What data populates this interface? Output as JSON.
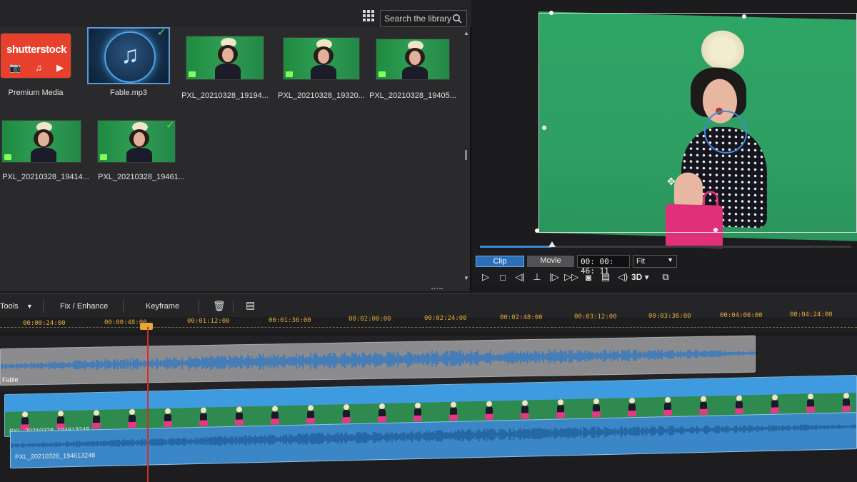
{
  "library": {
    "search_placeholder": "Search the library",
    "items": [
      {
        "label": "Premium Media",
        "kind": "shutterstock",
        "logo": "shutterstock"
      },
      {
        "label": "Fable.mp3",
        "kind": "music",
        "checked": true
      },
      {
        "label": "PXL_20210328_19194...",
        "kind": "video"
      },
      {
        "label": "PXL_20210328_19320...",
        "kind": "video"
      },
      {
        "label": "PXL_20210328_19405...",
        "kind": "video"
      },
      {
        "label": "PXL_20210328_19414...",
        "kind": "video"
      },
      {
        "label": "PXL_20210328_19461...",
        "kind": "video",
        "checked": true
      }
    ]
  },
  "preview": {
    "mode_clip": "Clip",
    "mode_movie": "Movie",
    "active_mode": "Clip",
    "timecode": "00: 00: 46: 11",
    "fit": "Fit",
    "three_d": "3D",
    "scrub_progress": 0.2
  },
  "toolbar": {
    "tools": "Tools",
    "fix_enhance": "Fix / Enhance",
    "keyframe": "Keyframe"
  },
  "ruler": {
    "ticks": [
      "00:00:24:00",
      "00:00:48:00",
      "00:01:12:00",
      "00:01:36:00",
      "00:02:00:00",
      "00:02:24:00",
      "00:02:48:00",
      "00:03:12:00",
      "00:03:36:00",
      "00:04:00:00",
      "00:04:24:00"
    ]
  },
  "tracks": {
    "audio_label": "Fable",
    "video_label": "PXL_20210328_194613248",
    "video_audio_label": "PXL_20210328_194613248"
  },
  "colors": {
    "accent": "#3a8ad8",
    "ruler": "#e2a93a",
    "playhead": "#d12f2f",
    "greenscreen": "#2ea565"
  }
}
